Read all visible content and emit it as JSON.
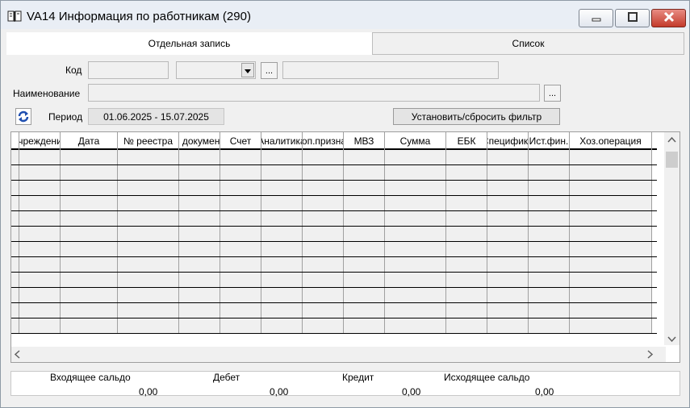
{
  "window": {
    "title": "VA14 Информация по работникам (290)",
    "icon": "book-icon",
    "controls": {
      "minimize": "minimize-icon",
      "maximize": "maximize-icon",
      "close": "close-icon"
    }
  },
  "tabs": [
    {
      "label": "Отдельная запись",
      "active": true
    },
    {
      "label": "Список",
      "active": false
    }
  ],
  "form": {
    "code_label": "Код",
    "code_value": "",
    "code_combo_value": "",
    "code_name_value": "",
    "name_label": "Наименование",
    "name_value": "",
    "ellipsis": "...",
    "period_label": "Период",
    "period_value": "01.06.2025  -  15.07.2025",
    "filter_button": "Установить/сбросить фильтр"
  },
  "grid": {
    "columns": [
      "Учреждение",
      "Дата",
      "№ реестра",
      "№ документа",
      "Счет",
      "Аналитика",
      "Доп.признак",
      "МВЗ",
      "Сумма",
      "ЕБК",
      "Специфика",
      "Ист.фин.",
      "Хоз.операция"
    ],
    "rows": [
      [],
      [],
      [],
      [],
      [],
      [],
      [],
      [],
      [],
      [],
      [],
      []
    ]
  },
  "totals": {
    "opening_label": "Входящее сальдо",
    "opening_value": "0,00",
    "debit_label": "Дебет",
    "debit_value": "0,00",
    "credit_label": "Кредит",
    "credit_value": "0,00",
    "closing_label": "Исходящее сальдо",
    "closing_value": "0,00"
  },
  "colors": {
    "accent_close": "#c33b2c",
    "background": "#f0f0f0"
  }
}
